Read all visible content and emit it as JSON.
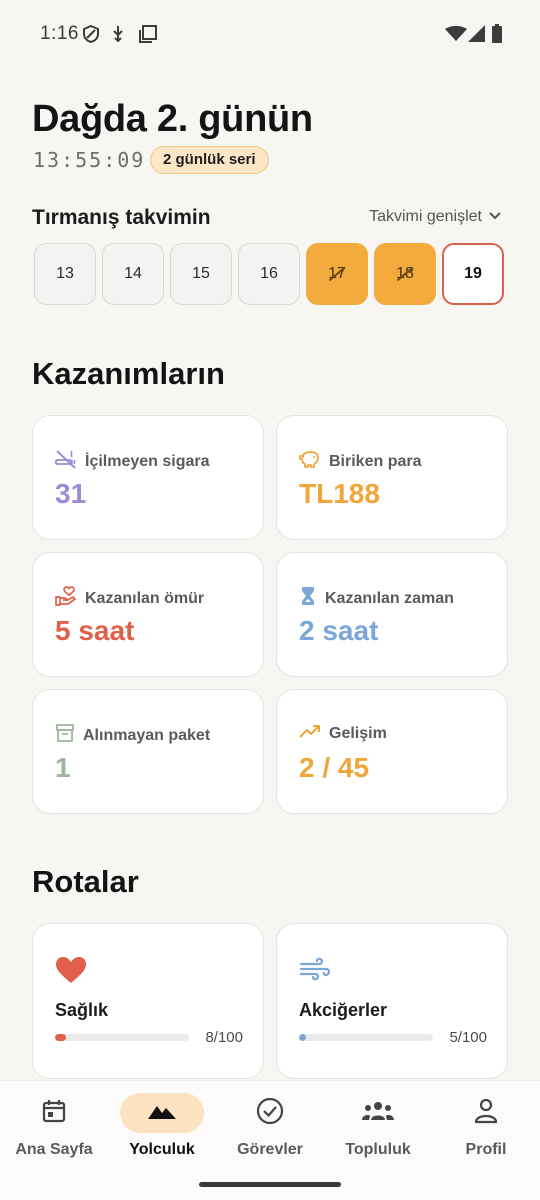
{
  "status_bar": {
    "time": "1:16"
  },
  "header": {
    "title": "Dağda 2. günün",
    "timer": "13:55:09",
    "streak": "2 günlük seri"
  },
  "calendar": {
    "label": "Tırmanış takvimin",
    "expand_label": "Takvimi genişlet",
    "days": [
      {
        "label": "13",
        "state": "empty"
      },
      {
        "label": "14",
        "state": "empty"
      },
      {
        "label": "15",
        "state": "empty"
      },
      {
        "label": "16",
        "state": "empty"
      },
      {
        "label": "17",
        "state": "done"
      },
      {
        "label": "18",
        "state": "done"
      },
      {
        "label": "19",
        "state": "today"
      }
    ]
  },
  "gains": {
    "title": "Kazanımların",
    "cards": [
      {
        "label": "İçilmeyen sigara",
        "value": "31",
        "icon": "no-smoking-icon",
        "color": "#9d8bd6"
      },
      {
        "label": "Biriken para",
        "value": "TL188",
        "icon": "piggy-bank-icon",
        "color": "#f0a63a"
      },
      {
        "label": "Kazanılan ömür",
        "value": "5 saat",
        "icon": "heart-hand-icon",
        "color": "#e0604b"
      },
      {
        "label": "Kazanılan zaman",
        "value": "2 saat",
        "icon": "hourglass-icon",
        "color": "#7ba7d6"
      },
      {
        "label": "Alınmayan paket",
        "value": "1",
        "icon": "package-icon",
        "color": "#9bb89a"
      },
      {
        "label": "Gelişim",
        "value": "2 / 45",
        "icon": "trend-up-icon",
        "color": "#f0a63a"
      }
    ]
  },
  "routes": {
    "title": "Rotalar",
    "items": [
      {
        "label": "Sağlık",
        "count": "8/100",
        "progress": 0.08,
        "icon": "heart-icon",
        "color": "#e0604b"
      },
      {
        "label": "Akciğerler",
        "count": "5/100",
        "progress": 0.05,
        "icon": "wind-icon",
        "color": "#7ba7d6"
      }
    ]
  },
  "nav": {
    "items": [
      {
        "label": "Ana Sayfa",
        "icon": "calendar-icon"
      },
      {
        "label": "Yolculuk",
        "icon": "mountain-icon",
        "active": true
      },
      {
        "label": "Görevler",
        "icon": "check-circle-icon"
      },
      {
        "label": "Topluluk",
        "icon": "people-icon"
      },
      {
        "label": "Profil",
        "icon": "person-icon"
      }
    ]
  },
  "colors": {
    "accent": "#f2ab3c",
    "today_border": "#d9624c",
    "background": "#f8f6f3"
  }
}
